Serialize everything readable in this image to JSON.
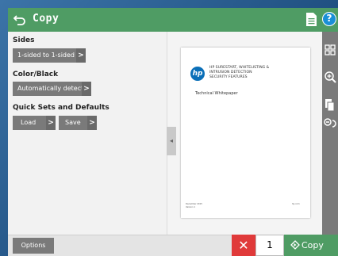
{
  "header": {
    "title": "Copy",
    "back_icon": "back-arrow-icon",
    "document_icon": "document-icon",
    "help_icon": "help-icon",
    "help_glyph": "?",
    "colors": {
      "header_bg": "#4f9c64",
      "help": "#1a8fd6"
    }
  },
  "settings": {
    "sides": {
      "label": "Sides",
      "value": "1-sided to 1-sided"
    },
    "color": {
      "label": "Color/Black",
      "value": "Automatically detect"
    },
    "quick_sets": {
      "label": "Quick Sets and Defaults",
      "load": "Load",
      "save": "Save"
    },
    "chevron": ">"
  },
  "preview": {
    "document": {
      "logo": "hp",
      "title_line1": "HP SURESTART, WHITELISTING &",
      "title_line2": "INTRUSION DETECTION",
      "title_line3": "SECURITY FEATURES",
      "subtitle": "Technical Whitepaper",
      "footer_left_1": "December 2015",
      "footer_left_2": "Version 1",
      "footer_right": "hp.com"
    },
    "collapse_glyph": "◂"
  },
  "footer": {
    "options": "Options",
    "cancel_glyph": "✕",
    "copies": "1",
    "copy": "Copy",
    "colors": {
      "cancel": "#e03a3a",
      "copy": "#4f9c64"
    }
  }
}
